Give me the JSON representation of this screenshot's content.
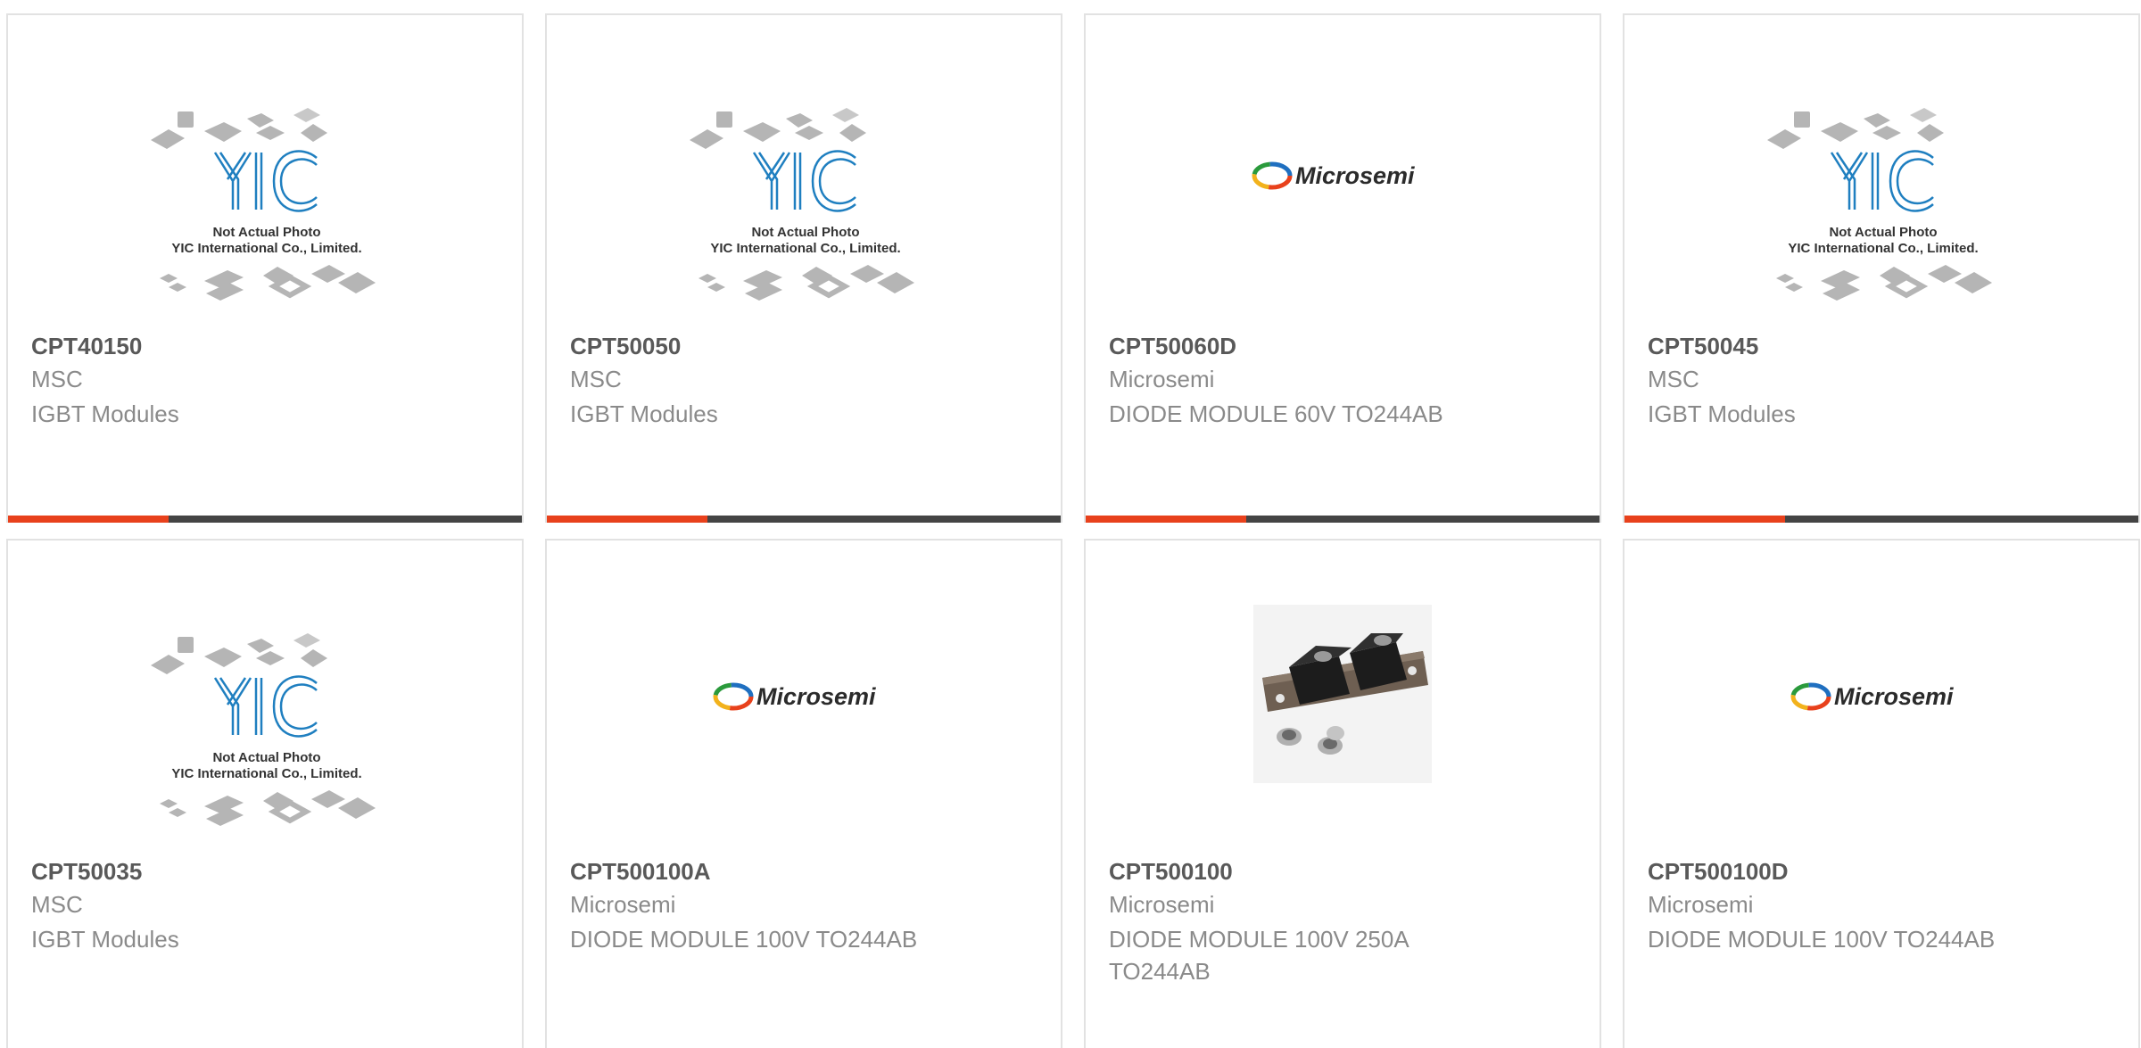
{
  "placeholder_image": {
    "line1": "Not Actual Photo",
    "line2": "YIC International Co., Limited.",
    "logo_text": "YIC"
  },
  "microsemi_logo_text": "Microsemi",
  "products": [
    {
      "part": "CPT40150",
      "mfr": "MSC",
      "desc": "IGBT Modules",
      "image": "yic-placeholder"
    },
    {
      "part": "CPT50050",
      "mfr": "MSC",
      "desc": "IGBT Modules",
      "image": "yic-placeholder"
    },
    {
      "part": "CPT50060D",
      "mfr": "Microsemi",
      "desc": "DIODE MODULE 60V TO244AB",
      "image": "microsemi-logo"
    },
    {
      "part": "CPT50045",
      "mfr": "MSC",
      "desc": "IGBT Modules",
      "image": "yic-placeholder"
    },
    {
      "part": "CPT50035",
      "mfr": "MSC",
      "desc": "IGBT Modules",
      "image": "yic-placeholder"
    },
    {
      "part": "CPT500100A",
      "mfr": "Microsemi",
      "desc": "DIODE MODULE 100V TO244AB",
      "image": "microsemi-logo"
    },
    {
      "part": "CPT500100",
      "mfr": "Microsemi",
      "desc": "DIODE MODULE 100V 250A TO244AB",
      "image": "diode-module-photo"
    },
    {
      "part": "CPT500100D",
      "mfr": "Microsemi",
      "desc": "DIODE MODULE 100V TO244AB",
      "image": "microsemi-logo"
    }
  ],
  "colors": {
    "accent": "#e8411c",
    "bar": "#444444",
    "yic_blue": "#1f7fc0"
  }
}
